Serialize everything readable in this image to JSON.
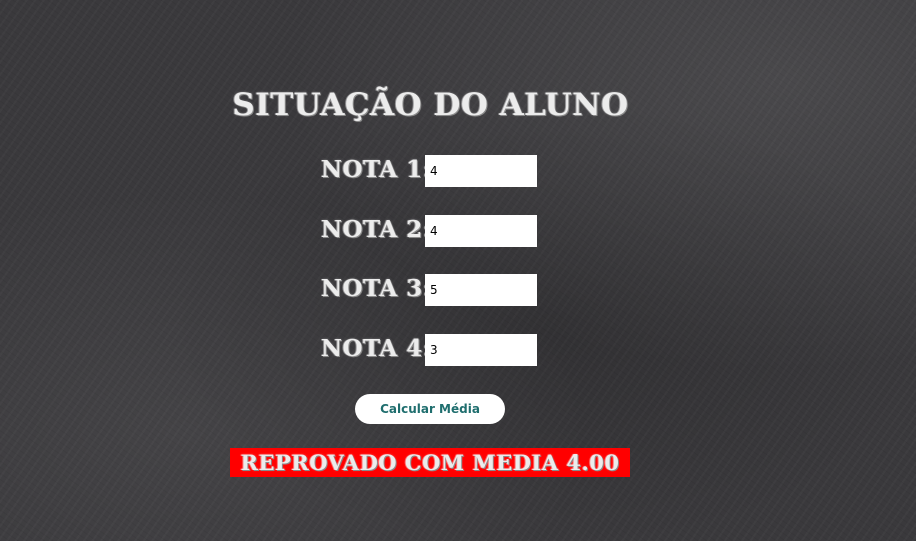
{
  "page": {
    "title": "SITUAÇÃO DO ALUNO"
  },
  "form": {
    "fields": [
      {
        "label": "NOTA 1:",
        "value": "4"
      },
      {
        "label": "NOTA 2:",
        "value": "4"
      },
      {
        "label": "NOTA 3:",
        "value": "5"
      },
      {
        "label": "NOTA 4:",
        "value": "3"
      }
    ],
    "submit_label": "Calcular Média"
  },
  "result": {
    "text": "REPROVADO COM MEDIA 4.00",
    "background_color": "#ff0000"
  },
  "colors": {
    "background": "#3a393c",
    "chalk_text": "#ececec",
    "button_text": "#1f6e6e"
  }
}
